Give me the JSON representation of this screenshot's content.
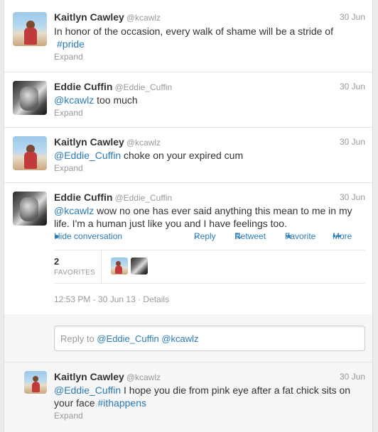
{
  "tweets": [
    {
      "name": "Kaitlyn Cawley",
      "handle": "@kcawlz",
      "date": "30 Jun",
      "text": "In honor of the occasion, every walk of shame will be a stride of",
      "hashtag": "#pride",
      "expand": "Expand"
    },
    {
      "name": "Eddie Cuffin",
      "handle": "@Eddie_Cuffin",
      "date": "30 Jun",
      "mention": "@kcawlz",
      "text": "too much",
      "expand": "Expand"
    },
    {
      "name": "Kaitlyn Cawley",
      "handle": "@kcawlz",
      "date": "30 Jun",
      "mention": "@Eddie_Cuffin",
      "text": "choke on your expired cum",
      "expand": "Expand"
    },
    {
      "name": "Eddie Cuffin",
      "handle": "@Eddie_Cuffin",
      "date": "30 Jun",
      "mention": "@kcawlz",
      "text_line1": "wow no one has ever said anything this mean to me in my",
      "text_line2": "life. I'm a human just like you and I have feelings too.",
      "hide_conversation": "Hide conversation",
      "reply": "Reply",
      "retweet": "Retweet",
      "favorite": "Favorite",
      "more": "More",
      "favorites_count": "2",
      "favorites_label": "FAVORITES",
      "timestamp": "12:53 PM - 30 Jun 13",
      "details": "Details"
    },
    {
      "name": "Kaitlyn Cawley",
      "handle": "@kcawlz",
      "date": "30 Jun",
      "mention": "@Eddie_Cuffin",
      "text_line1": "I hope you die from pink eye after a fat chick sits on",
      "text_line2": "your face",
      "hashtag": "#ithappens",
      "expand": "Expand"
    }
  ],
  "reply_box": {
    "prefix": "Reply to",
    "recipients": "@Eddie_Cuffin @kcawlz"
  },
  "icons": {
    "speech": "speech-bubble-icon",
    "reply": "reply-arrow-icon",
    "retweet": "retweet-icon",
    "favorite": "star-icon",
    "more": "more-dots-icon"
  },
  "colors": {
    "link": "#2a7bb5",
    "muted": "#999999"
  }
}
